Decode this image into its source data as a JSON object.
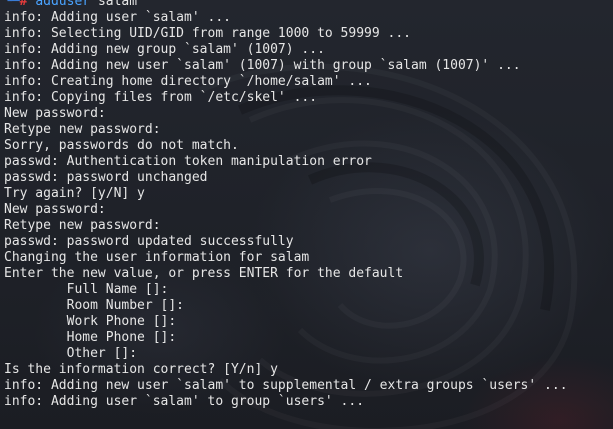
{
  "prompt": {
    "corner": "└─",
    "symbol": "#",
    "command": "adduser",
    "argument": "salam"
  },
  "output_lines": [
    "info: Adding user `salam' ...",
    "info: Selecting UID/GID from range 1000 to 59999 ...",
    "info: Adding new group `salam' (1007) ...",
    "info: Adding new user `salam' (1007) with group `salam (1007)' ...",
    "info: Creating home directory `/home/salam' ...",
    "info: Copying files from `/etc/skel' ...",
    "New password:",
    "Retype new password:",
    "Sorry, passwords do not match.",
    "passwd: Authentication token manipulation error",
    "passwd: password unchanged",
    "Try again? [y/N] y",
    "New password:",
    "Retype new password:",
    "passwd: password updated successfully",
    "Changing the user information for salam",
    "Enter the new value, or press ENTER for the default",
    "        Full Name []:",
    "        Room Number []:",
    "        Work Phone []:",
    "        Home Phone []:",
    "        Other []:",
    "Is the information correct? [Y/n] y",
    "info: Adding new user `salam' to supplemental / extra groups `users' ...",
    "info: Adding user `salam' to group `users' ..."
  ],
  "colors": {
    "background": "#1e2129",
    "text": "#e6e6e6",
    "prompt_corner": "#3a7bd5",
    "prompt_symbol": "#e23b3b",
    "command": "#4aa3ff"
  }
}
